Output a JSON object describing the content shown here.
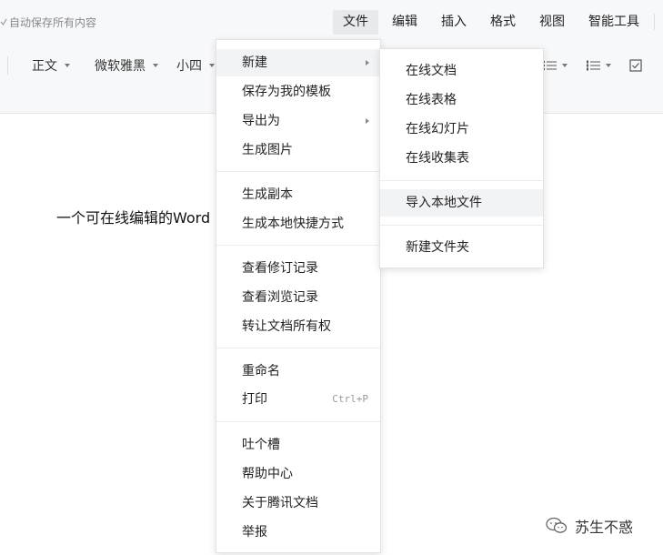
{
  "header": {
    "autosave_text": "自动保存所有内容",
    "menus": [
      {
        "label": "文件",
        "active": true
      },
      {
        "label": "编辑"
      },
      {
        "label": "插入"
      },
      {
        "label": "格式"
      },
      {
        "label": "视图"
      },
      {
        "label": "智能工具"
      }
    ]
  },
  "toolbar": {
    "paragraph_style": "正文",
    "font_family": "微软雅黑",
    "font_size": "小四",
    "icons": [
      "bullet-list-icon",
      "numbered-list-icon",
      "checkbox-icon"
    ]
  },
  "document": {
    "body_text": "一个可在线编辑的Word"
  },
  "file_menu": {
    "groups": [
      [
        {
          "label": "新建",
          "submenu": true
        },
        {
          "label": "保存为我的模板"
        },
        {
          "label": "导出为",
          "submenu": true
        },
        {
          "label": "生成图片"
        }
      ],
      [
        {
          "label": "生成副本"
        },
        {
          "label": "生成本地快捷方式"
        }
      ],
      [
        {
          "label": "查看修订记录"
        },
        {
          "label": "查看浏览记录"
        },
        {
          "label": "转让文档所有权"
        }
      ],
      [
        {
          "label": "重命名"
        },
        {
          "label": "打印",
          "shortcut": "Ctrl+P"
        }
      ],
      [
        {
          "label": "吐个槽"
        },
        {
          "label": "帮助中心"
        },
        {
          "label": "关于腾讯文档"
        },
        {
          "label": "举报"
        }
      ]
    ]
  },
  "new_submenu": {
    "groups": [
      [
        {
          "label": "在线文档"
        },
        {
          "label": "在线表格"
        },
        {
          "label": "在线幻灯片"
        },
        {
          "label": "在线收集表"
        }
      ],
      [
        {
          "label": "导入本地文件",
          "hovered": true
        }
      ],
      [
        {
          "label": "新建文件夹"
        }
      ]
    ]
  },
  "watermark": {
    "text": "苏生不惑"
  },
  "colors": {
    "toolbar_bg": "#f7f8fa",
    "active_menu_bg": "#e8e9ec",
    "hover_item_bg": "#f2f3f5"
  }
}
